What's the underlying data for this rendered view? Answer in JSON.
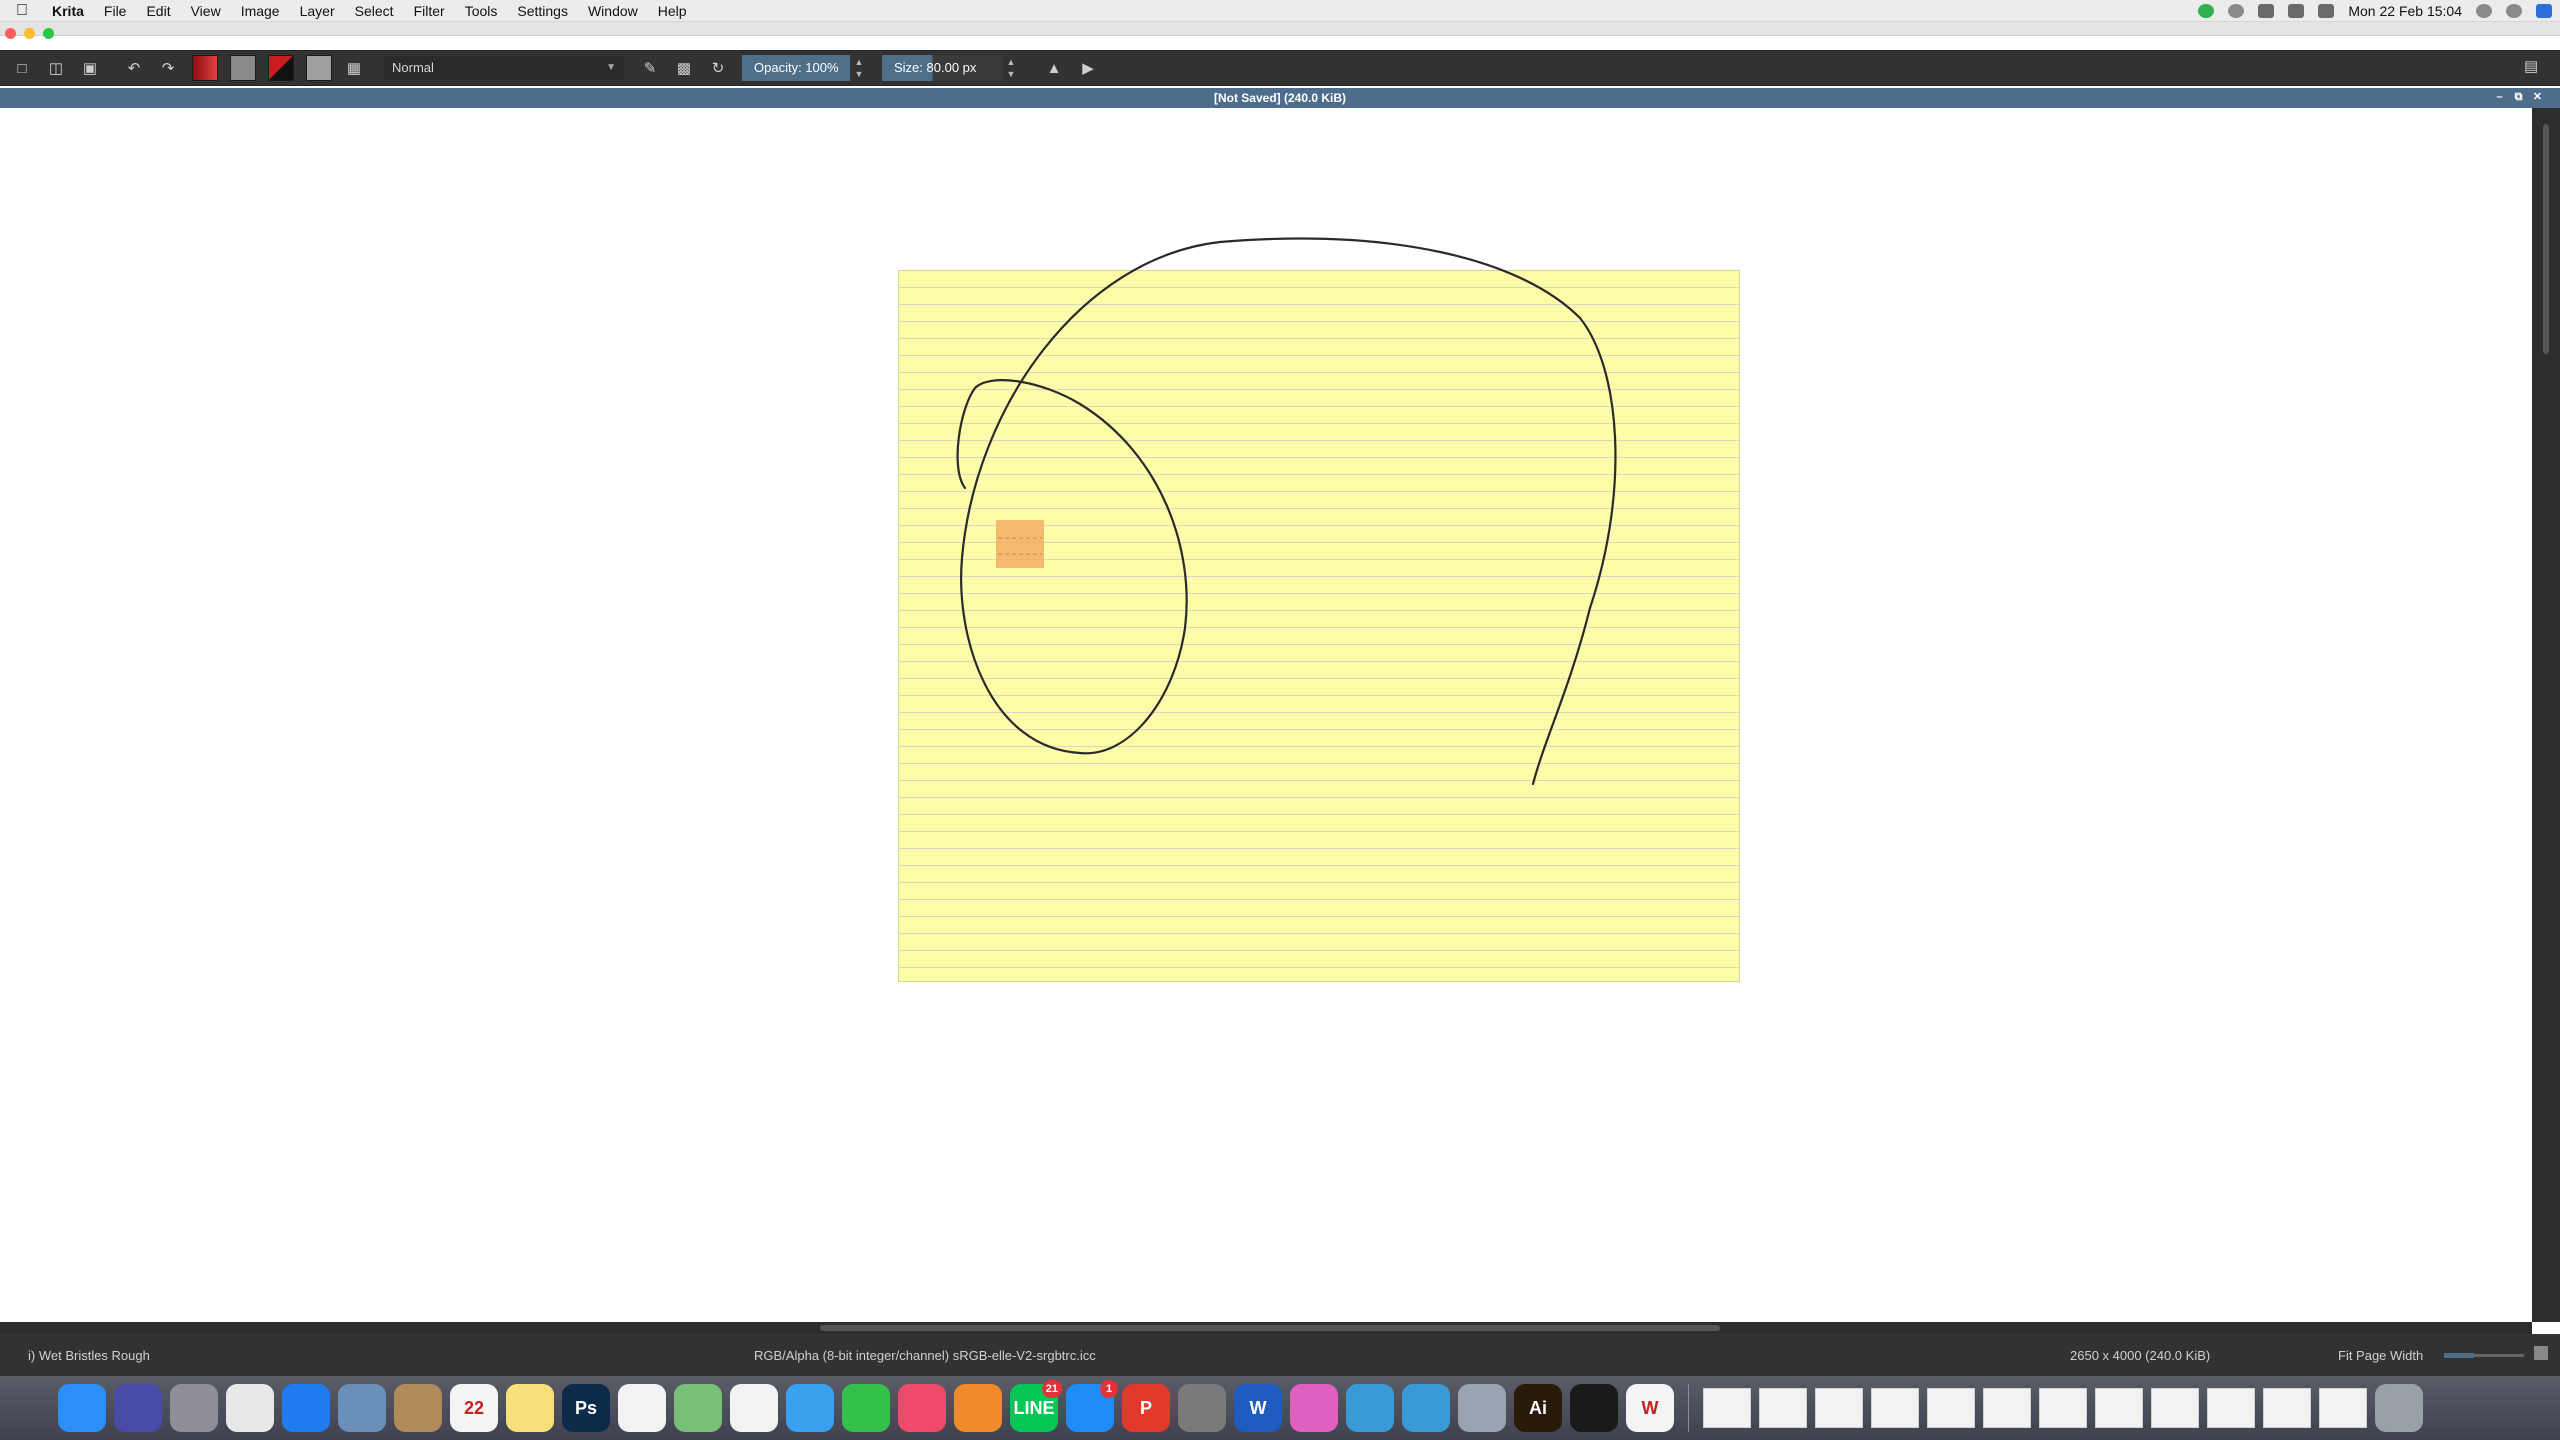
{
  "menubar": {
    "app_name": "Krita",
    "items": [
      "File",
      "Edit",
      "View",
      "Image",
      "Layer",
      "Select",
      "Filter",
      "Tools",
      "Settings",
      "Window",
      "Help"
    ],
    "clock": "Mon 22 Feb  15:04"
  },
  "toolbar": {
    "blend_mode": "Normal",
    "opacity_label": "Opacity: 100%",
    "size_label": "Size: 80.00 px",
    "foreground_color": "#c81e1e",
    "background_color": "#9a9a9a"
  },
  "document": {
    "title": "[Not Saved]  (240.0 KiB)",
    "paper_color": "#fdfca8",
    "note_color": "#f5b36a"
  },
  "statusbar": {
    "brush_preset": "i) Wet Bristles Rough",
    "color_profile": "RGB/Alpha (8-bit integer/channel)  sRGB-elle-V2-srgbtrc.icc",
    "image_size": "2650 x 4000 (240.0 KiB)",
    "zoom_mode": "Fit Page Width"
  },
  "dock": {
    "apps": [
      {
        "name": "finder",
        "label": "",
        "color": "#2c8ef8"
      },
      {
        "name": "siri",
        "label": "",
        "color": "#4a4aa8"
      },
      {
        "name": "launchpad",
        "label": "",
        "color": "#8e8e96"
      },
      {
        "name": "chrome",
        "label": "",
        "color": "#e8e8e8"
      },
      {
        "name": "safari",
        "label": "",
        "color": "#1e7cf0"
      },
      {
        "name": "preview",
        "label": "",
        "color": "#6a8fb8"
      },
      {
        "name": "contacts",
        "label": "",
        "color": "#b08a58"
      },
      {
        "name": "calendar",
        "label": "22",
        "color": "#f4f4f4"
      },
      {
        "name": "notes",
        "label": "",
        "color": "#f7e07a"
      },
      {
        "name": "photoshop",
        "label": "Ps",
        "color": "#0e2a4a"
      },
      {
        "name": "reminders",
        "label": "",
        "color": "#f2f2f2"
      },
      {
        "name": "maps",
        "label": "",
        "color": "#78c078"
      },
      {
        "name": "photos",
        "label": "",
        "color": "#f2f2f2"
      },
      {
        "name": "messages",
        "label": "",
        "color": "#3aa0f0"
      },
      {
        "name": "facetime",
        "label": "",
        "color": "#34c04a"
      },
      {
        "name": "music",
        "label": "",
        "color": "#f04a6a"
      },
      {
        "name": "books",
        "label": "",
        "color": "#f08a2a"
      },
      {
        "name": "line",
        "label": "LINE",
        "color": "#06c755",
        "badge": "21"
      },
      {
        "name": "app-store",
        "label": "",
        "color": "#1e8cf4",
        "badge": "1"
      },
      {
        "name": "wps-presentation",
        "label": "P",
        "color": "#e23a2a"
      },
      {
        "name": "system-preferences",
        "label": "",
        "color": "#7a7a7a"
      },
      {
        "name": "word",
        "label": "W",
        "color": "#1e5cc0"
      },
      {
        "name": "krita",
        "label": "",
        "color": "#e060c0"
      },
      {
        "name": "people",
        "label": "",
        "color": "#3a9ad8"
      },
      {
        "name": "network",
        "label": "",
        "color": "#3a9ad8"
      },
      {
        "name": "image-capture",
        "label": "",
        "color": "#9aa4b0"
      },
      {
        "name": "illustrator",
        "label": "Ai",
        "color": "#2a1a08"
      },
      {
        "name": "acrobat",
        "label": "",
        "color": "#1a1a1a"
      },
      {
        "name": "wps",
        "label": "W",
        "color": "#f4f4f4"
      }
    ],
    "window_thumbnails": 12
  }
}
